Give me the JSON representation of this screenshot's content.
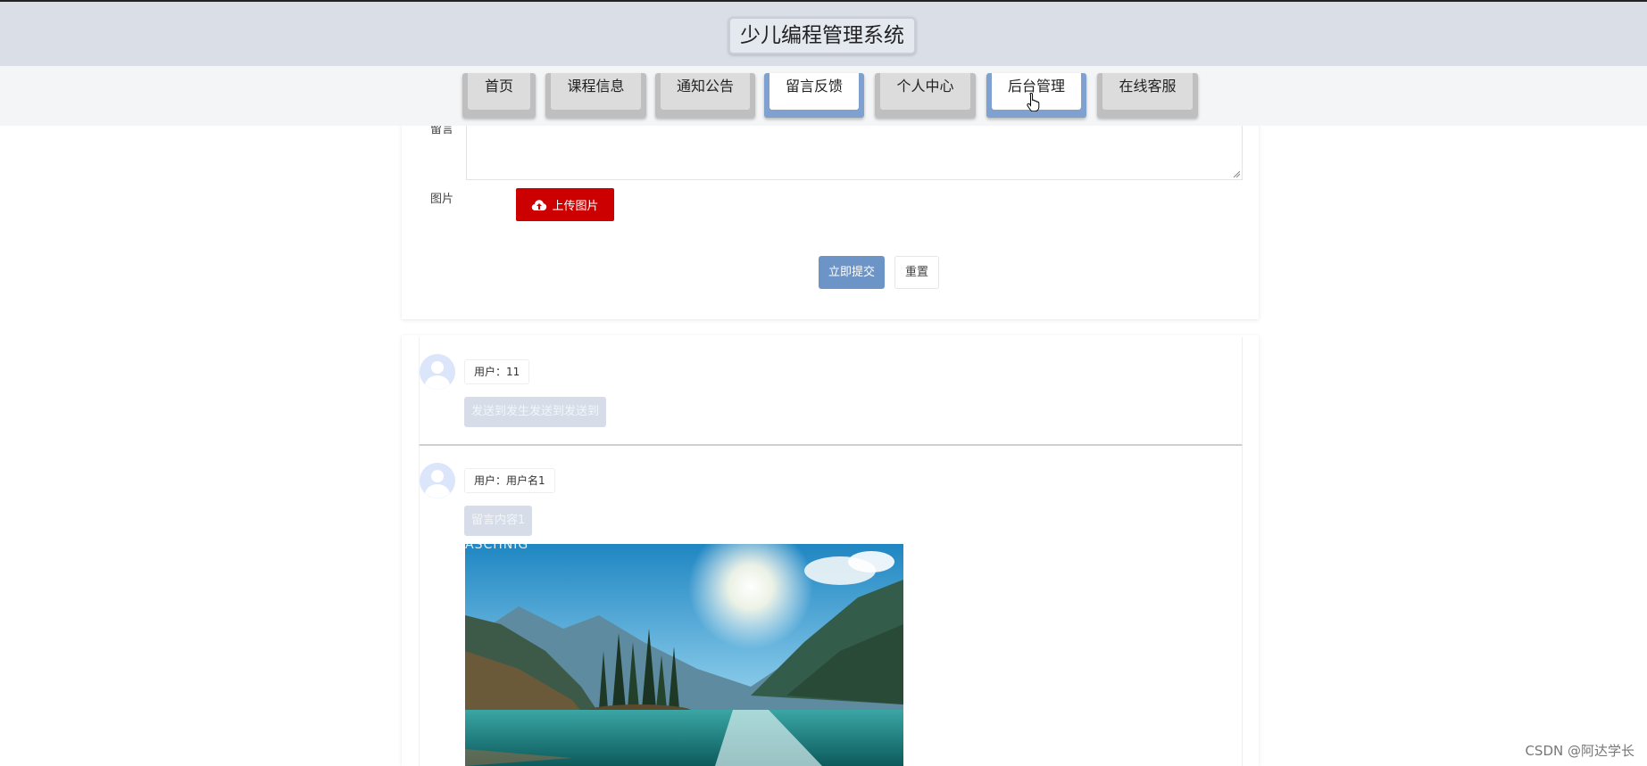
{
  "header": {
    "title": "少儿编程管理系统"
  },
  "nav": {
    "items": [
      {
        "label": "首页",
        "active": false
      },
      {
        "label": "课程信息",
        "active": false
      },
      {
        "label": "通知公告",
        "active": false
      },
      {
        "label": "留言反馈",
        "active": true
      },
      {
        "label": "个人中心",
        "active": false
      },
      {
        "label": "后台管理",
        "active": true
      },
      {
        "label": "在线客服",
        "active": false
      }
    ]
  },
  "form": {
    "message_label": "留言",
    "image_label": "图片",
    "upload_label": "上传图片",
    "upload_icon": "cloud-upload-icon",
    "submit_label": "立即提交",
    "reset_label": "重置"
  },
  "comments": [
    {
      "user": "用户：11",
      "content": "发送到发生发送到发送到",
      "has_image": false
    },
    {
      "user": "用户：用户名1",
      "content": "留言内容1",
      "has_image": true,
      "image_watermark": "ASCHNIG"
    }
  ],
  "watermark": "CSDN @阿达学长",
  "colors": {
    "header_bg": "#d9dee7",
    "active_nav": "#7ea1cf",
    "upload_btn": "#cc0000",
    "submit_btn": "#6d94c7"
  }
}
